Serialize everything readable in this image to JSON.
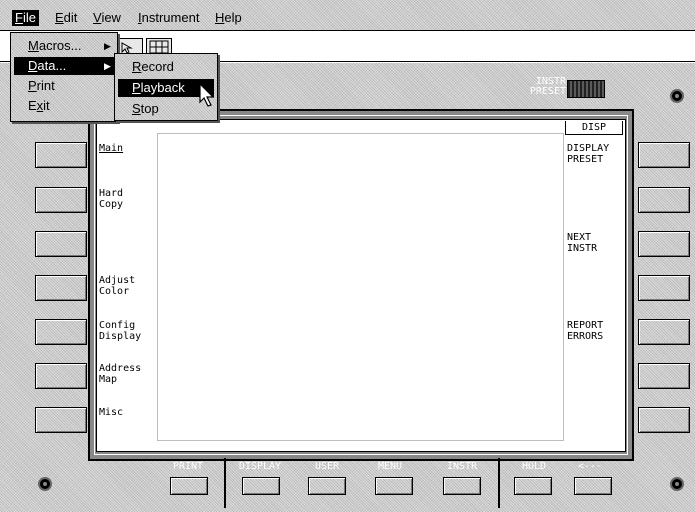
{
  "menubar": {
    "items": [
      {
        "pre": "",
        "ul": "F",
        "post": "ile"
      },
      {
        "pre": "",
        "ul": "E",
        "post": "dit"
      },
      {
        "pre": "",
        "ul": "V",
        "post": "iew"
      },
      {
        "pre": "",
        "ul": "I",
        "post": "nstrument"
      },
      {
        "pre": "",
        "ul": "H",
        "post": "elp"
      }
    ]
  },
  "file_menu": {
    "items": [
      {
        "ul": "M",
        "post": "acros...",
        "submenu": true
      },
      {
        "ul": "D",
        "post": "ata...",
        "submenu": true
      },
      {
        "ul": "P",
        "post": "rint",
        "submenu": false
      },
      {
        "pre": "E",
        "ul": "x",
        "post": "it",
        "submenu": false
      }
    ]
  },
  "data_submenu": {
    "items": [
      {
        "ul": "R",
        "post": "ecord"
      },
      {
        "ul": "P",
        "post": "layback"
      },
      {
        "ul": "S",
        "post": "top"
      }
    ]
  },
  "instrument": {
    "instr_preset": "INSTR\nPRESET",
    "disp": "DISP",
    "left_softkeys": [
      "Main",
      "Hard\nCopy",
      "",
      "Adjust\nColor",
      "Config\nDisplay",
      "Address\nMap",
      "Misc"
    ],
    "right_softkeys": [
      "DISPLAY\nPRESET",
      "",
      "NEXT\nINSTR",
      "",
      "REPORT\nERRORS",
      "",
      ""
    ],
    "bottom_keys": [
      "PRINT",
      "DISPLAY",
      "USER",
      "MENU",
      "INSTR",
      "HOLD",
      "<---"
    ]
  },
  "colors": {
    "panel": "#c4c4c4",
    "highlight": "#000000",
    "menu_text": "#000000"
  }
}
